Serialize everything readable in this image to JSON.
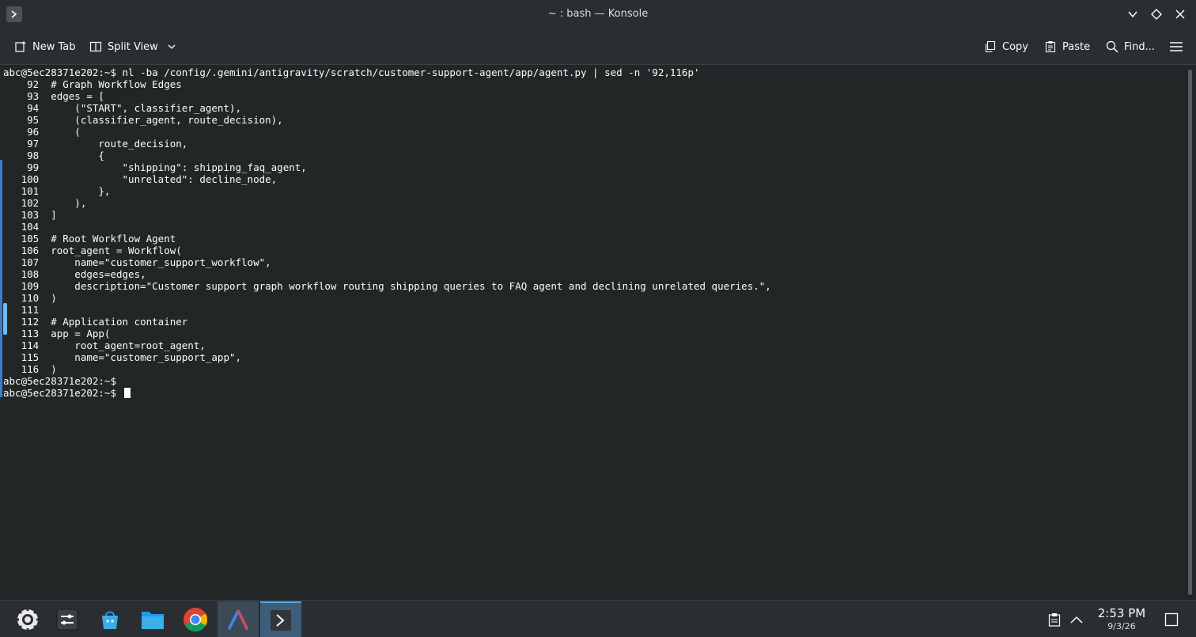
{
  "window": {
    "title": "~ : bash — Konsole"
  },
  "toolbar": {
    "new_tab": "New Tab",
    "split_view": "Split View",
    "copy": "Copy",
    "paste": "Paste",
    "find": "Find..."
  },
  "terminal": {
    "lines": [
      "abc@5ec28371e202:~$ nl -ba /config/.gemini/antigravity/scratch/customer-support-agent/app/agent.py | sed -n '92,116p'",
      "    92  # Graph Workflow Edges",
      "    93  edges = [",
      "    94      (\"START\", classifier_agent),",
      "    95      (classifier_agent, route_decision),",
      "    96      (",
      "    97          route_decision,",
      "    98          {",
      "    99              \"shipping\": shipping_faq_agent,",
      "   100              \"unrelated\": decline_node,",
      "   101          },",
      "   102      ),",
      "   103  ]",
      "   104",
      "   105  # Root Workflow Agent",
      "   106  root_agent = Workflow(",
      "   107      name=\"customer_support_workflow\",",
      "   108      edges=edges,",
      "   109      description=\"Customer support graph workflow routing shipping queries to FAQ agent and declining unrelated queries.\",",
      "   110  )",
      "   111",
      "   112  # Application container",
      "   113  app = App(",
      "   114      root_agent=root_agent,",
      "   115      name=\"customer_support_app\",",
      "   116  )",
      "abc@5ec28371e202:~$",
      "abc@5ec28371e202:~$ "
    ]
  },
  "taskbar": {
    "apps": [
      "launcher-icon",
      "system-settings-icon",
      "discover-store-icon",
      "file-manager-icon",
      "chrome-icon",
      "antigravity-icon",
      "konsole-icon"
    ],
    "clock": {
      "time": "2:53 PM",
      "date": "9/3/26"
    }
  },
  "colors": {
    "background": "#232627",
    "chrome": "#2a2e32",
    "accent": "#3d7cc9",
    "text": "#fcfcfc"
  }
}
